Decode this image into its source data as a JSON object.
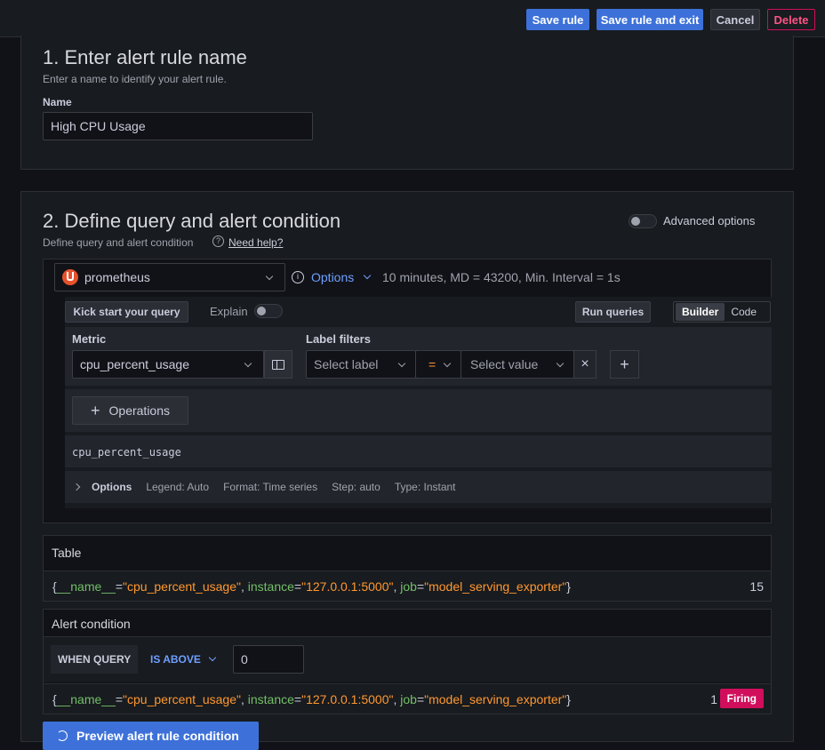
{
  "toolbar": {
    "save_rule": "Save rule",
    "save_exit": "Save rule and exit",
    "cancel": "Cancel",
    "delete": "Delete"
  },
  "section1": {
    "title": "1. Enter alert rule name",
    "description": "Enter a name to identify your alert rule.",
    "name_label": "Name",
    "name_value": "High CPU Usage"
  },
  "section2": {
    "title": "2. Define query and alert condition",
    "description": "Define query and alert condition",
    "help_link": "Need help?",
    "advanced_options": "Advanced options",
    "datasource": "prometheus",
    "options_link": "Options",
    "options_summary": "10 minutes, MD = 43200, Min. Interval = 1s",
    "kickstart": "Kick start your query",
    "explain": "Explain",
    "run_queries": "Run queries",
    "mode_builder": "Builder",
    "mode_code": "Code",
    "metric_label": "Metric",
    "metric_value": "cpu_percent_usage",
    "label_filters_label": "Label filters",
    "select_label": "Select label",
    "operator": "=",
    "select_value": "Select value",
    "operations": "Operations",
    "query_preview": "cpu_percent_usage",
    "options_row": {
      "title": "Options",
      "legend": "Legend: Auto",
      "format": "Format: Time series",
      "step": "Step: auto",
      "type": "Type: Instant"
    }
  },
  "table": {
    "title": "Table",
    "row": {
      "name_key": "__name__",
      "name_val": "\"cpu_percent_usage\"",
      "instance_key": "instance",
      "instance_val": "\"127.0.0.1:5000\"",
      "job_key": "job",
      "job_val": "\"model_serving_exporter\"",
      "value": "15"
    }
  },
  "alert_condition": {
    "title": "Alert condition",
    "when_query": "WHEN QUERY",
    "is_above": "IS ABOVE",
    "threshold": "0",
    "result_value": "1",
    "status": "Firing"
  },
  "preview_button": "Preview alert rule condition",
  "colors": {
    "primary": "#3d71d9",
    "firing": "#d10e5c",
    "label_key": "#73bf69",
    "label_val": "#ff9830"
  }
}
